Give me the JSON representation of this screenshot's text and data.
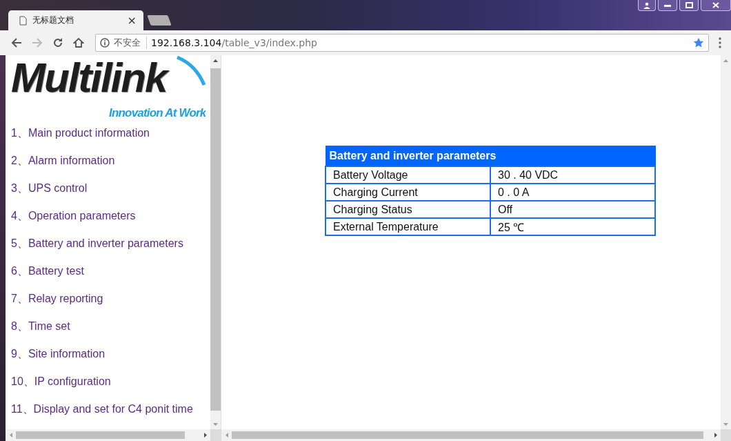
{
  "browser": {
    "tab_title": "无标题文档",
    "tab_close": "×",
    "security_label": "不安全",
    "url_host": "192.168.3.104",
    "url_path": "/table_v3/index.php"
  },
  "sidebar": {
    "logo": {
      "wordmark": "Multilink",
      "tagline": "Innovation At Work"
    },
    "links": [
      {
        "number": "1、",
        "label": "Main product information"
      },
      {
        "number": "2、",
        "label": "Alarm information"
      },
      {
        "number": "3、",
        "label": "UPS control"
      },
      {
        "number": "4、",
        "label": "Operation parameters"
      },
      {
        "number": "5、",
        "label": "Battery and inverter parameters"
      },
      {
        "number": "6、",
        "label": "Battery test"
      },
      {
        "number": "7、",
        "label": "Relay reporting"
      },
      {
        "number": "8、",
        "label": "Time set"
      },
      {
        "number": "9、",
        "label": "Site information"
      },
      {
        "number": "10、",
        "label": "IP configuration"
      },
      {
        "number": "11、",
        "label": "Display and set for C4 ponit time"
      }
    ]
  },
  "table": {
    "title": "Battery and inverter parameters",
    "rows": [
      {
        "name": "Battery Voltage",
        "value": "30 . 40 VDC"
      },
      {
        "name": "Charging Current",
        "value": "0 . 0 A"
      },
      {
        "name": "Charging Status",
        "value": "Off"
      },
      {
        "name": "External Temperature",
        "value": "25 ℃"
      }
    ]
  }
}
